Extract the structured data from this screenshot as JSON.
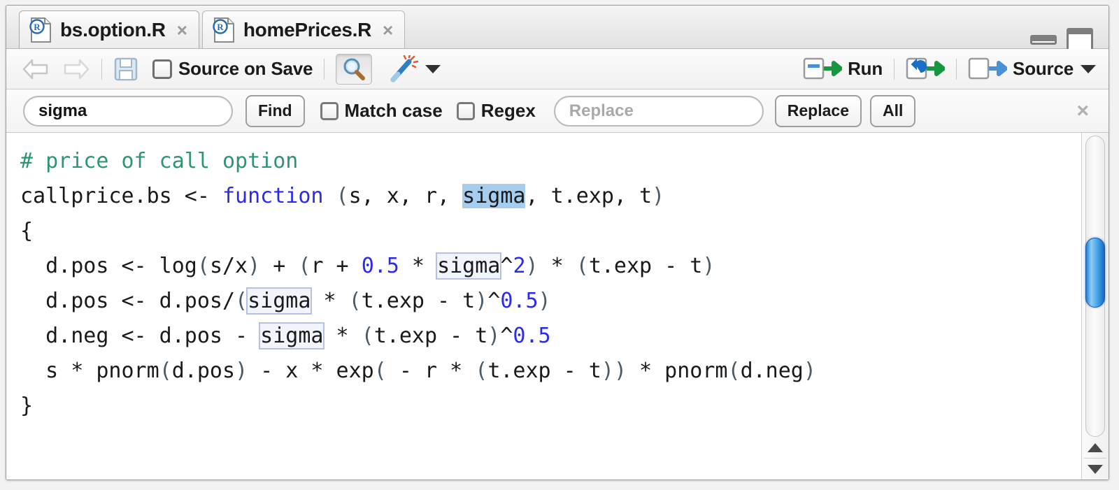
{
  "window": {
    "controls": [
      {
        "name": "minimize",
        "label": "Minimize"
      },
      {
        "name": "maximize",
        "label": "Maximize"
      }
    ]
  },
  "tabs": [
    {
      "label": "bs.option.R",
      "icon": "r-file-icon",
      "close": "×",
      "active": true
    },
    {
      "label": "homePrices.R",
      "icon": "r-file-icon",
      "close": "×",
      "active": false
    }
  ],
  "toolbar": {
    "back_icon": "⇦",
    "forward_icon": "⇨",
    "save_icon": "save-icon",
    "source_on_save_label": "Source on Save",
    "source_on_save_checked": false,
    "find_icon": "magnifier-icon",
    "wand_icon": "magic-wand-icon",
    "wand_caret": "▼",
    "run_label": "Run",
    "rerun_icon": "re-run-icon",
    "source_label": "Source",
    "source_caret": "▼"
  },
  "find_bar": {
    "find_value": "sigma",
    "find_placeholder": "Find",
    "find_button": "Find",
    "match_case_label": "Match case",
    "match_case_checked": false,
    "regex_label": "Regex",
    "regex_checked": false,
    "replace_value": "",
    "replace_placeholder": "Replace",
    "replace_button": "Replace",
    "all_button": "All",
    "close_icon": "×"
  },
  "editor": {
    "lines": [
      "# price of call option",
      "callprice.bs <- function (s, x, r, sigma, t.exp, t)",
      "{",
      "  d.pos <- log(s/x) + (r + 0.5 * sigma^2) * (t.exp - t)",
      "  d.pos <- d.pos/(sigma * (t.exp - t)^0.5)",
      "  d.neg <- d.pos - sigma * (t.exp - t)^0.5",
      "  s * pnorm(d.pos) - x * exp( - r * (t.exp - t)) * pnorm(d.neg)",
      "}"
    ],
    "search_term": "sigma",
    "active_match_index": 0,
    "total_matches": 4,
    "colors": {
      "comment": "#2e9478",
      "keyword": "#2b2bf0",
      "number": "#2b2bf0",
      "active_highlight": "#a6cdee",
      "match_outline": "#b9bfe4",
      "text": "#1a1a1a"
    }
  },
  "scrollbar": {
    "orientation": "vertical",
    "thumb_position_percent": 44,
    "up_arrow": "▲",
    "down_arrow": "▼"
  }
}
